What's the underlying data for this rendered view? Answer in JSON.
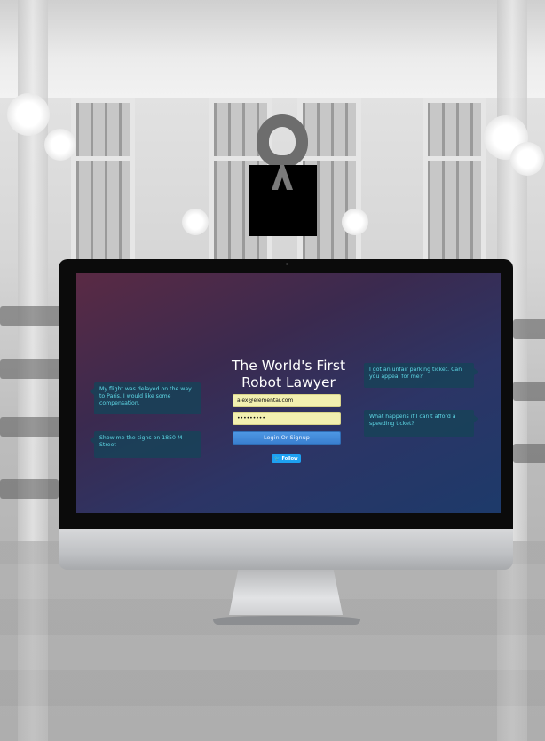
{
  "screen": {
    "headline_line1": "The World's First",
    "headline_line2": "Robot Lawyer",
    "email_value": "alex@elementai.com",
    "password_value": "•••••••••",
    "login_button_label": "Login Or Signup",
    "follow_button_label": "Follow",
    "follow_icon": "twitter-bird-icon",
    "bubbles": [
      {
        "text": "My flight was delayed on the way to Paris. I would like some compensation."
      },
      {
        "text": "Show me the signs on 1850 M Street"
      },
      {
        "text": "I got an unfair parking ticket. Can you appeal for me?"
      },
      {
        "text": "What happens if I can't afford a speeding ticket?"
      }
    ]
  },
  "colors": {
    "bubble_text": "#5ed8e6",
    "login_button": "#3a7fd0",
    "follow_button": "#1da1f2",
    "input_fill": "#f2f0b0"
  }
}
